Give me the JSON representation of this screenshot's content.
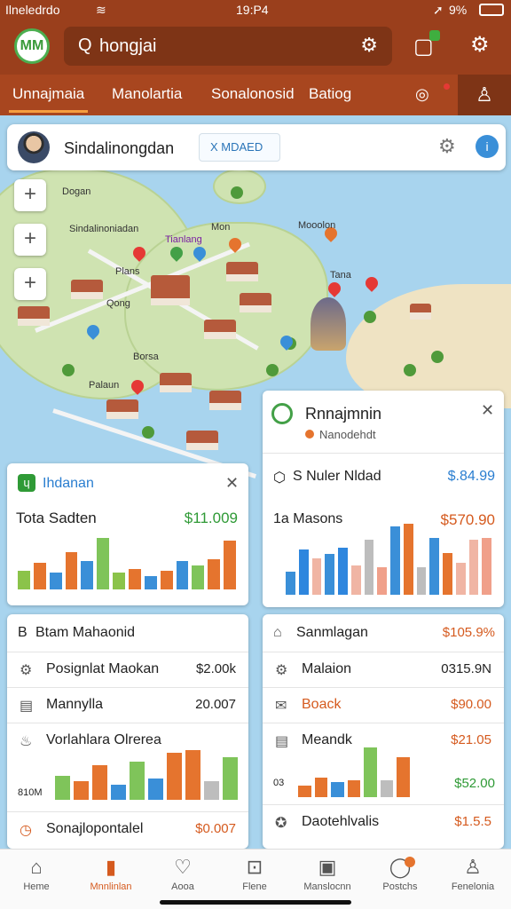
{
  "status": {
    "carrier": "Ilneledrdo",
    "time": "19:P4",
    "battery": "9%"
  },
  "header": {
    "logo_text": "MM",
    "search_value": "hongjai"
  },
  "tabs": [
    {
      "label": "Unnajmaia",
      "active": true
    },
    {
      "label": "Manolartia",
      "active": false
    },
    {
      "label": "Sonalonosid",
      "active": false
    },
    {
      "label": "Batiog",
      "active": false
    }
  ],
  "infobar": {
    "name": "Sindalinongdan",
    "chip": "X MDAED"
  },
  "map_labels": [
    "Dogan",
    "Sindalinoniadan",
    "Mon",
    "Tianlang",
    "Mooolon",
    "Plans",
    "Qong",
    "Borsa",
    "Palaun",
    "Tana"
  ],
  "card_left": {
    "title": "Ihdanan",
    "metric_label": "Tota Sadten",
    "metric_value": "$11.009",
    "chart": [
      {
        "value": 20,
        "color": "#8bc34a"
      },
      {
        "value": 28,
        "color": "#e5742e"
      },
      {
        "value": 18,
        "color": "#3a8fd8"
      },
      {
        "value": 40,
        "color": "#e5742e"
      },
      {
        "value": 30,
        "color": "#3a8fd8"
      },
      {
        "value": 55,
        "color": "#7fc45a"
      },
      {
        "value": 18,
        "color": "#8bc34a"
      },
      {
        "value": 22,
        "color": "#e5742e"
      },
      {
        "value": 14,
        "color": "#3a8fd8"
      },
      {
        "value": 20,
        "color": "#e5742e"
      },
      {
        "value": 30,
        "color": "#3a8fd8"
      },
      {
        "value": 26,
        "color": "#7fc45a"
      },
      {
        "value": 32,
        "color": "#e5742e"
      },
      {
        "value": 52,
        "color": "#e5742e"
      }
    ]
  },
  "card_right": {
    "title": "Rnnajmnin",
    "subtitle": "Nanodehdt",
    "row1_label": "S Nuler Nldad",
    "row1_value": "$.84.99",
    "metric_label": "1a Masons",
    "metric_value": "$570.90",
    "chart": [
      {
        "value": 25,
        "color": "#3a8fd8"
      },
      {
        "value": 50,
        "color": "#2e86de"
      },
      {
        "value": 40,
        "color": "#f0b5a4"
      },
      {
        "value": 45,
        "color": "#3a8fd8"
      },
      {
        "value": 52,
        "color": "#2e86de"
      },
      {
        "value": 32,
        "color": "#f0b5a4"
      },
      {
        "value": 60,
        "color": "#bdbdbd"
      },
      {
        "value": 30,
        "color": "#f0a08a"
      },
      {
        "value": 75,
        "color": "#3a8fd8"
      },
      {
        "value": 78,
        "color": "#e5742e"
      },
      {
        "value": 30,
        "color": "#bdbdbd"
      },
      {
        "value": 62,
        "color": "#3a8fd8"
      },
      {
        "value": 46,
        "color": "#e5742e"
      },
      {
        "value": 35,
        "color": "#f0b5a4"
      },
      {
        "value": 60,
        "color": "#f0b5a4"
      },
      {
        "value": 62,
        "color": "#f0a08a"
      }
    ]
  },
  "list_left": {
    "title": "Btam Mahaonid",
    "rows": [
      {
        "icon": "⚙",
        "label": "Posignlat Maokan",
        "value": "$2.00k"
      },
      {
        "icon": "▤",
        "label": "Mannylla",
        "value": "20.007"
      }
    ],
    "chart_label": "Vorlahlara Olrerea",
    "chart_axis": "810M",
    "chart": [
      {
        "value": 28,
        "color": "#7fc45a"
      },
      {
        "value": 22,
        "color": "#e5742e"
      },
      {
        "value": 40,
        "color": "#e5742e"
      },
      {
        "value": 18,
        "color": "#3a8fd8"
      },
      {
        "value": 45,
        "color": "#7fc45a"
      },
      {
        "value": 25,
        "color": "#3a8fd8"
      },
      {
        "value": 55,
        "color": "#e5742e"
      },
      {
        "value": 58,
        "color": "#e5742e"
      },
      {
        "value": 22,
        "color": "#bdbdbd"
      },
      {
        "value": 50,
        "color": "#7fc45a"
      }
    ],
    "footer_label": "Sonajlopontalel",
    "footer_value": "$0.007"
  },
  "list_right": {
    "title": "Sanmlagan",
    "title_value": "$105.9%",
    "rows": [
      {
        "icon": "⚙",
        "label": "Malaion",
        "value": "0315.9N"
      },
      {
        "icon": "✉",
        "label": "Boack",
        "value": "$90.00"
      },
      {
        "icon": "▤",
        "label": "Meandk",
        "value": "$21.05"
      }
    ],
    "chart_axis": "03",
    "chart_value": "$52.00",
    "chart": [
      {
        "value": 12,
        "color": "#e5742e"
      },
      {
        "value": 20,
        "color": "#e5742e"
      },
      {
        "value": 16,
        "color": "#3a8fd8"
      },
      {
        "value": 18,
        "color": "#e5742e"
      },
      {
        "value": 52,
        "color": "#7fc45a"
      },
      {
        "value": 18,
        "color": "#bdbdbd"
      },
      {
        "value": 42,
        "color": "#e5742e"
      }
    ],
    "footer_label": "Daotehlvalis",
    "footer_value": "$1.5.5"
  },
  "bottom_nav": [
    {
      "label": "Heme",
      "icon": "⌂",
      "active": false
    },
    {
      "label": "Mnnlinlan",
      "icon": "▮",
      "active": true
    },
    {
      "label": "Aooa",
      "icon": "♡",
      "active": false
    },
    {
      "label": "Flene",
      "icon": "⊡",
      "active": false
    },
    {
      "label": "Manslocnn",
      "icon": "▣",
      "active": false
    },
    {
      "label": "Postchs",
      "icon": "◯",
      "active": false
    },
    {
      "label": "Fenelonia",
      "icon": "♙",
      "active": false
    }
  ],
  "colors": {
    "header": "#9a3f1c",
    "tabs": "#a8461f",
    "accent": "#d55a1e",
    "green": "#2f9a36",
    "blue": "#2a7ed0",
    "water": "#a8d4ee",
    "land": "#cfe3b1"
  },
  "icons": [
    "wifi-icon",
    "battery-icon",
    "search-icon",
    "gear-icon",
    "wallet-icon",
    "settings-icon",
    "bell-icon",
    "user-icon",
    "plus-icon",
    "close-icon",
    "home-icon",
    "heart-icon"
  ]
}
